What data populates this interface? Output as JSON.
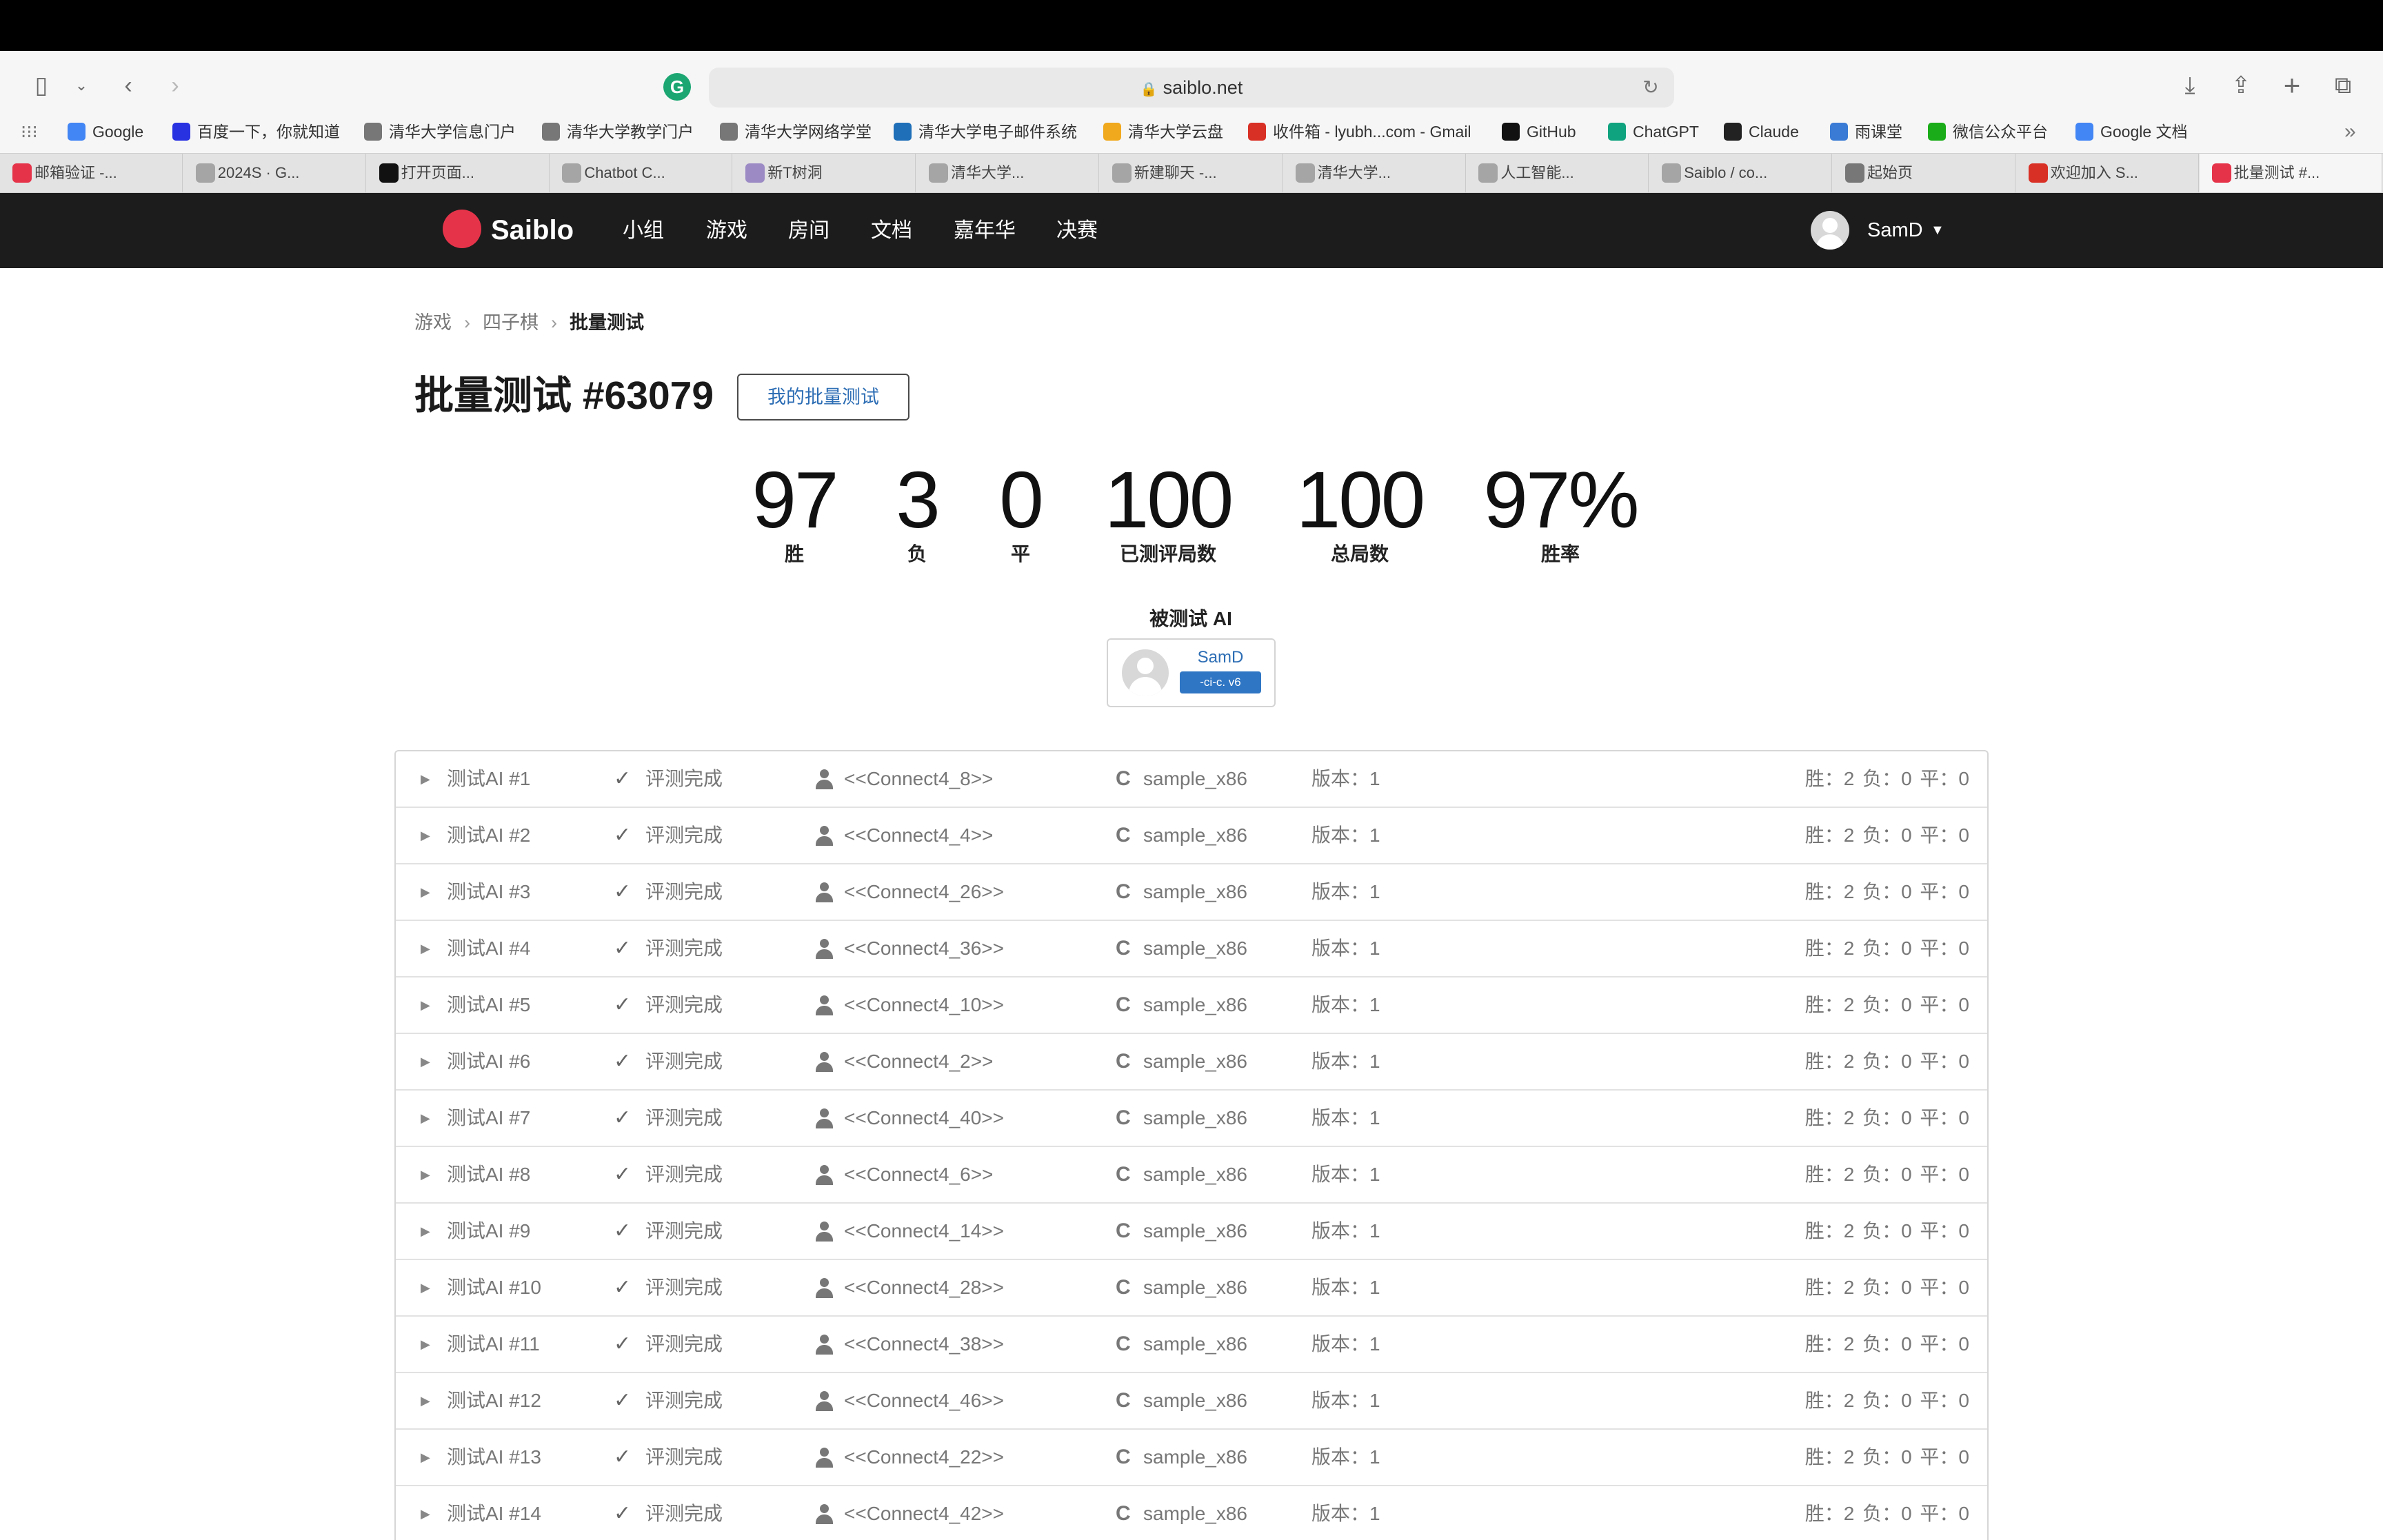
{
  "browser": {
    "url": "saiblo.net",
    "bookmarks": [
      {
        "label": "Google",
        "icon": "google-icon",
        "color": "#4285f4"
      },
      {
        "label": "百度一下，你就知道",
        "icon": "baidu-icon",
        "color": "#2932e1"
      },
      {
        "label": "清华大学信息门户",
        "icon": "globe-icon",
        "color": "#777777"
      },
      {
        "label": "清华大学教学门户",
        "icon": "globe-icon",
        "color": "#777777"
      },
      {
        "label": "清华大学网络学堂",
        "icon": "globe-icon",
        "color": "#777777"
      },
      {
        "label": "清华大学电子邮件系统",
        "icon": "c-mail-icon",
        "color": "#1e6fb8"
      },
      {
        "label": "清华大学云盘",
        "icon": "cloud-icon",
        "color": "#f0a81c"
      },
      {
        "label": "收件箱 - lyubh...com - Gmail",
        "icon": "gmail-icon",
        "color": "#d93025"
      },
      {
        "label": "GitHub",
        "icon": "github-icon",
        "color": "#111111"
      },
      {
        "label": "ChatGPT",
        "icon": "chatgpt-icon",
        "color": "#10a37f"
      },
      {
        "label": "Claude",
        "icon": "claude-icon",
        "color": "#222222"
      },
      {
        "label": "雨课堂",
        "icon": "rain-classroom-icon",
        "color": "#3a7bd5"
      },
      {
        "label": "微信公众平台",
        "icon": "wechat-icon",
        "color": "#1aad19"
      },
      {
        "label": "Google 文档",
        "icon": "docs-icon",
        "color": "#4285f4"
      }
    ],
    "tabs": [
      {
        "label": "邮箱验证 -...",
        "icon": "saiblo-icon",
        "color": "#e5344a"
      },
      {
        "label": "2024S · G...",
        "icon": "t-icon",
        "color": "#a5a5a5"
      },
      {
        "label": "打开页面...",
        "icon": "x-icon",
        "color": "#111111"
      },
      {
        "label": "Chatbot C...",
        "icon": "p-icon",
        "color": "#a5a5a5"
      },
      {
        "label": "新T树洞",
        "icon": "treehole-icon",
        "color": "#9b8ac4"
      },
      {
        "label": "清华大学...",
        "icon": "t-icon",
        "color": "#a5a5a5"
      },
      {
        "label": "新建聊天 -...",
        "icon": "p-icon",
        "color": "#a5a5a5"
      },
      {
        "label": "清华大学...",
        "icon": "t-icon",
        "color": "#a5a5a5"
      },
      {
        "label": "人工智能...",
        "icon": "t-icon",
        "color": "#a5a5a5"
      },
      {
        "label": "Saiblo / co...",
        "icon": "t-icon",
        "color": "#a5a5a5"
      },
      {
        "label": "起始页",
        "icon": "star-icon",
        "color": "#777777"
      },
      {
        "label": "欢迎加入 S...",
        "icon": "gmail-icon",
        "color": "#d93025"
      },
      {
        "label": "批量测试 #...",
        "icon": "saiblo-icon",
        "color": "#e5344a"
      }
    ]
  },
  "site": {
    "brand": "Saiblo",
    "nav": [
      "小组",
      "游戏",
      "房间",
      "文档",
      "嘉年华",
      "决赛"
    ],
    "user": "SamD"
  },
  "breadcrumb": [
    "游戏",
    "四子棋",
    "批量测试"
  ],
  "title": "批量测试 #63079",
  "my_batch_button": "我的批量测试",
  "stats": [
    {
      "value": "97",
      "label": "胜"
    },
    {
      "value": "3",
      "label": "负"
    },
    {
      "value": "0",
      "label": "平"
    },
    {
      "value": "100",
      "label": "已测评局数"
    },
    {
      "value": "100",
      "label": "总局数"
    },
    {
      "value": "97%",
      "label": "胜率"
    }
  ],
  "tested_ai": {
    "label": "被测试 AI",
    "user": "SamD",
    "badge": "-ci-c.   v6"
  },
  "rows": [
    {
      "name": "测试AI #1",
      "status": "评测完成",
      "opponent": "<<Connect4_8>>",
      "lang": "sample_x86",
      "version": "版本：1",
      "score": "胜：2  负：0  平：0"
    },
    {
      "name": "测试AI #2",
      "status": "评测完成",
      "opponent": "<<Connect4_4>>",
      "lang": "sample_x86",
      "version": "版本：1",
      "score": "胜：2  负：0  平：0"
    },
    {
      "name": "测试AI #3",
      "status": "评测完成",
      "opponent": "<<Connect4_26>>",
      "lang": "sample_x86",
      "version": "版本：1",
      "score": "胜：2  负：0  平：0"
    },
    {
      "name": "测试AI #4",
      "status": "评测完成",
      "opponent": "<<Connect4_36>>",
      "lang": "sample_x86",
      "version": "版本：1",
      "score": "胜：2  负：0  平：0"
    },
    {
      "name": "测试AI #5",
      "status": "评测完成",
      "opponent": "<<Connect4_10>>",
      "lang": "sample_x86",
      "version": "版本：1",
      "score": "胜：2  负：0  平：0"
    },
    {
      "name": "测试AI #6",
      "status": "评测完成",
      "opponent": "<<Connect4_2>>",
      "lang": "sample_x86",
      "version": "版本：1",
      "score": "胜：2  负：0  平：0"
    },
    {
      "name": "测试AI #7",
      "status": "评测完成",
      "opponent": "<<Connect4_40>>",
      "lang": "sample_x86",
      "version": "版本：1",
      "score": "胜：2  负：0  平：0"
    },
    {
      "name": "测试AI #8",
      "status": "评测完成",
      "opponent": "<<Connect4_6>>",
      "lang": "sample_x86",
      "version": "版本：1",
      "score": "胜：2  负：0  平：0"
    },
    {
      "name": "测试AI #9",
      "status": "评测完成",
      "opponent": "<<Connect4_14>>",
      "lang": "sample_x86",
      "version": "版本：1",
      "score": "胜：2  负：0  平：0"
    },
    {
      "name": "测试AI #10",
      "status": "评测完成",
      "opponent": "<<Connect4_28>>",
      "lang": "sample_x86",
      "version": "版本：1",
      "score": "胜：2  负：0  平：0"
    },
    {
      "name": "测试AI #11",
      "status": "评测完成",
      "opponent": "<<Connect4_38>>",
      "lang": "sample_x86",
      "version": "版本：1",
      "score": "胜：2  负：0  平：0"
    },
    {
      "name": "测试AI #12",
      "status": "评测完成",
      "opponent": "<<Connect4_46>>",
      "lang": "sample_x86",
      "version": "版本：1",
      "score": "胜：2  负：0  平：0"
    },
    {
      "name": "测试AI #13",
      "status": "评测完成",
      "opponent": "<<Connect4_22>>",
      "lang": "sample_x86",
      "version": "版本：1",
      "score": "胜：2  负：0  平：0"
    },
    {
      "name": "测试AI #14",
      "status": "评测完成",
      "opponent": "<<Connect4_42>>",
      "lang": "sample_x86",
      "version": "版本：1",
      "score": "胜：2  负：0  平：0"
    }
  ]
}
